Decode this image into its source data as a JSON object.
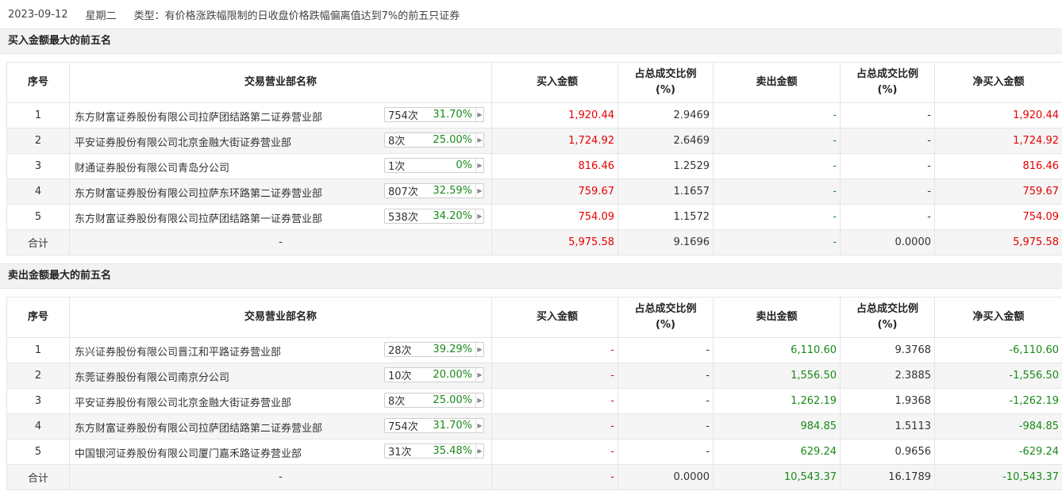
{
  "header": {
    "date": "2023-09-12",
    "weekday": "星期二",
    "type": "类型：有价格涨跌幅限制的日收盘价格跌幅偏离值达到7%的前五只证券"
  },
  "columns": [
    "序号",
    "交易营业部名称",
    "买入金额",
    "占总成交比例\n(%)",
    "卖出金额",
    "占总成交比例\n(%)",
    "净买入金额"
  ],
  "buy_section": {
    "title": "买入金额最大的前五名",
    "rows": [
      {
        "no": "1",
        "name": "东方财富证券股份有限公司拉萨团结路第二证券营业部",
        "count": "754次",
        "pct": "31.70%",
        "buy": "1,920.44",
        "buy_ratio": "2.9469",
        "sell": "-",
        "sell_ratio": "-",
        "net": "1,920.44"
      },
      {
        "no": "2",
        "name": "平安证券股份有限公司北京金融大街证券营业部",
        "count": "8次",
        "pct": "25.00%",
        "buy": "1,724.92",
        "buy_ratio": "2.6469",
        "sell": "-",
        "sell_ratio": "-",
        "net": "1,724.92"
      },
      {
        "no": "3",
        "name": "财通证券股份有限公司青岛分公司",
        "count": "1次",
        "pct": "0%",
        "buy": "816.46",
        "buy_ratio": "1.2529",
        "sell": "-",
        "sell_ratio": "-",
        "net": "816.46"
      },
      {
        "no": "4",
        "name": "东方财富证券股份有限公司拉萨东环路第二证券营业部",
        "count": "807次",
        "pct": "32.59%",
        "buy": "759.67",
        "buy_ratio": "1.1657",
        "sell": "-",
        "sell_ratio": "-",
        "net": "759.67"
      },
      {
        "no": "5",
        "name": "东方财富证券股份有限公司拉萨团结路第一证券营业部",
        "count": "538次",
        "pct": "34.20%",
        "buy": "754.09",
        "buy_ratio": "1.1572",
        "sell": "-",
        "sell_ratio": "-",
        "net": "754.09"
      }
    ],
    "total": {
      "label": "合计",
      "name": "-",
      "buy": "5,975.58",
      "buy_ratio": "9.1696",
      "sell": "-",
      "sell_ratio": "0.0000",
      "net": "5,975.58"
    }
  },
  "sell_section": {
    "title": "卖出金额最大的前五名",
    "rows": [
      {
        "no": "1",
        "name": "东兴证券股份有限公司晋江和平路证券营业部",
        "count": "28次",
        "pct": "39.29%",
        "buy": "-",
        "buy_ratio": "-",
        "sell": "6,110.60",
        "sell_ratio": "9.3768",
        "net": "-6,110.60"
      },
      {
        "no": "2",
        "name": "东莞证券股份有限公司南京分公司",
        "count": "10次",
        "pct": "20.00%",
        "buy": "-",
        "buy_ratio": "-",
        "sell": "1,556.50",
        "sell_ratio": "2.3885",
        "net": "-1,556.50"
      },
      {
        "no": "3",
        "name": "平安证券股份有限公司北京金融大街证券营业部",
        "count": "8次",
        "pct": "25.00%",
        "buy": "-",
        "buy_ratio": "-",
        "sell": "1,262.19",
        "sell_ratio": "1.9368",
        "net": "-1,262.19"
      },
      {
        "no": "4",
        "name": "东方财富证券股份有限公司拉萨团结路第二证券营业部",
        "count": "754次",
        "pct": "31.70%",
        "buy": "-",
        "buy_ratio": "-",
        "sell": "984.85",
        "sell_ratio": "1.5113",
        "net": "-984.85"
      },
      {
        "no": "5",
        "name": "中国银河证券股份有限公司厦门嘉禾路证券营业部",
        "count": "31次",
        "pct": "35.48%",
        "buy": "-",
        "buy_ratio": "-",
        "sell": "629.24",
        "sell_ratio": "0.9656",
        "net": "-629.24"
      }
    ],
    "total": {
      "label": "合计",
      "name": "-",
      "buy": "-",
      "buy_ratio": "0.0000",
      "sell": "10,543.37",
      "sell_ratio": "16.1789",
      "net": "-10,543.37"
    }
  },
  "colors": {
    "up": "#e60000",
    "down": "#1a8a1a",
    "neutral": "#333333"
  }
}
